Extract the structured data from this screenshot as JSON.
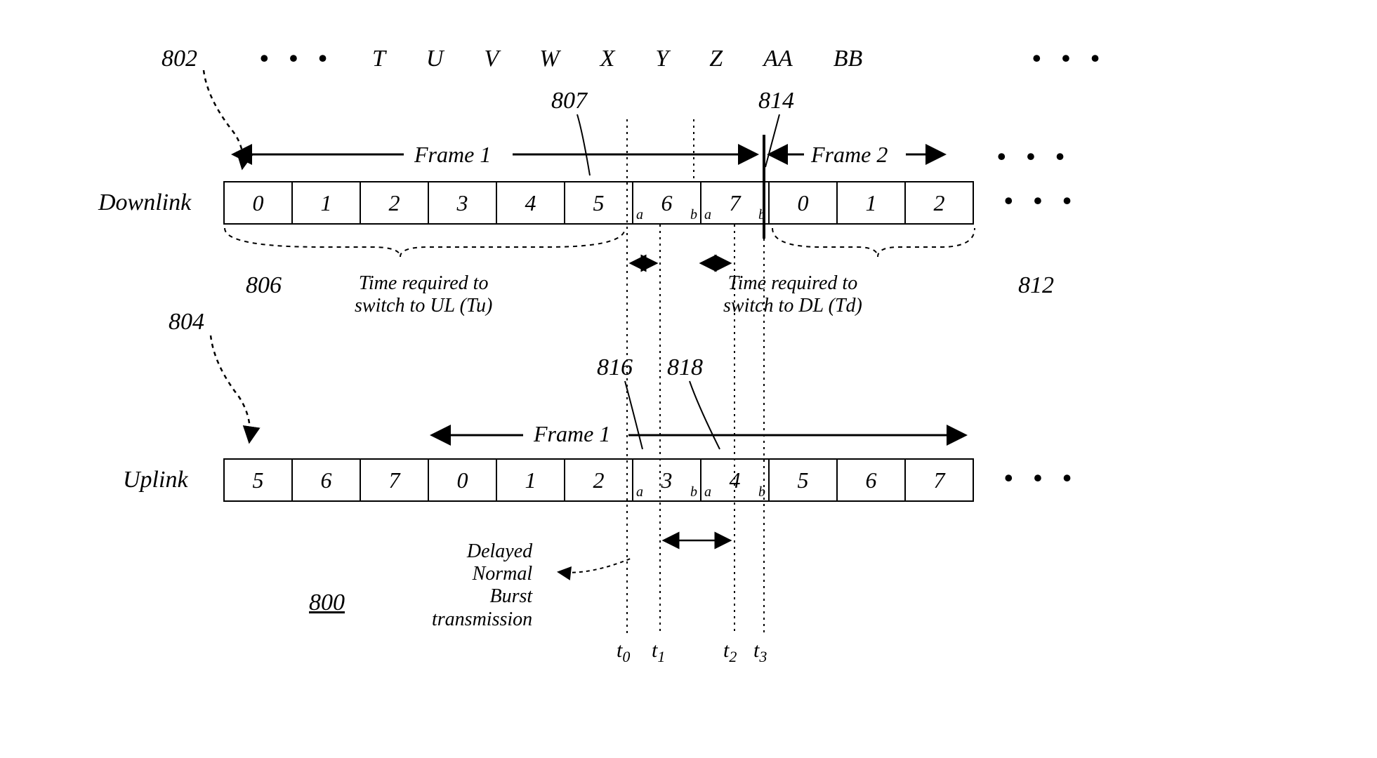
{
  "header": {
    "ref_left": "802",
    "letters": [
      "T",
      "U",
      "V",
      "W",
      "X",
      "Y",
      "Z",
      "AA",
      "BB"
    ]
  },
  "refs": {
    "r807": "807",
    "r814": "814",
    "r806": "806",
    "r812": "812",
    "r804": "804",
    "r816": "816",
    "r818": "818",
    "r800": "800"
  },
  "frames": {
    "f1": "Frame 1",
    "f2": "Frame 2"
  },
  "rows": {
    "downlink_label": "Downlink",
    "uplink_label": "Uplink",
    "downlink_cells": [
      "0",
      "1",
      "2",
      "3",
      "4",
      "5",
      "6",
      "7",
      "0",
      "1",
      "2"
    ],
    "uplink_cells": [
      "5",
      "6",
      "7",
      "0",
      "1",
      "2",
      "3",
      "4",
      "5",
      "6",
      "7"
    ]
  },
  "captions": {
    "switch_ul_l1": "Time required to",
    "switch_ul_l2": "switch to UL (Tu)",
    "switch_dl_l1": "Time required to",
    "switch_dl_l2": "switch to DL (Td)",
    "delayed_l1": "Delayed",
    "delayed_l2": "Normal",
    "delayed_l3": "Burst",
    "delayed_l4": "transmission"
  },
  "times": {
    "t0": "t",
    "t0s": "0",
    "t1": "t",
    "t1s": "1",
    "t2": "t",
    "t2s": "2",
    "t3": "t",
    "t3s": "3"
  },
  "dots": "• • •"
}
